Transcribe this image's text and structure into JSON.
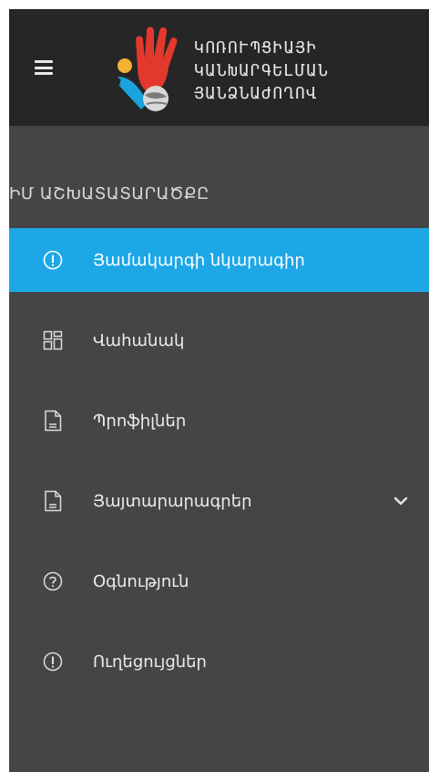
{
  "header": {
    "logo_lines": [
      "ԿՈՌՈՒՊՑԻԱՅԻ",
      "ԿԱՆԽԱՐԳԵԼՄԱՆ",
      "ՅԱՆՁՆԱԺՈՂՈՎ"
    ]
  },
  "sidebar": {
    "section_title": "ԻՄ ԱՇԽԱՏԱՏԱՐԱԾՔԸ",
    "items": [
      {
        "label": "Յամակարգի նկարագիր",
        "icon": "info-circle-icon",
        "active": true
      },
      {
        "label": "Վահանակ",
        "icon": "dashboard-icon",
        "active": false
      },
      {
        "label": "Պրոֆիլներ",
        "icon": "document-icon",
        "active": false
      },
      {
        "label": "Յայտարարագրեր",
        "icon": "document-icon",
        "active": false,
        "expandable": true
      },
      {
        "label": "Օգնություն",
        "icon": "question-circle-icon",
        "active": false
      },
      {
        "label": "Ուղեցույցներ",
        "icon": "info-circle-icon",
        "active": false
      }
    ]
  },
  "colors": {
    "sidebar_bg": "#454545",
    "header_bg": "#262626",
    "active_bg": "#1da7e6",
    "text": "#ececec"
  }
}
